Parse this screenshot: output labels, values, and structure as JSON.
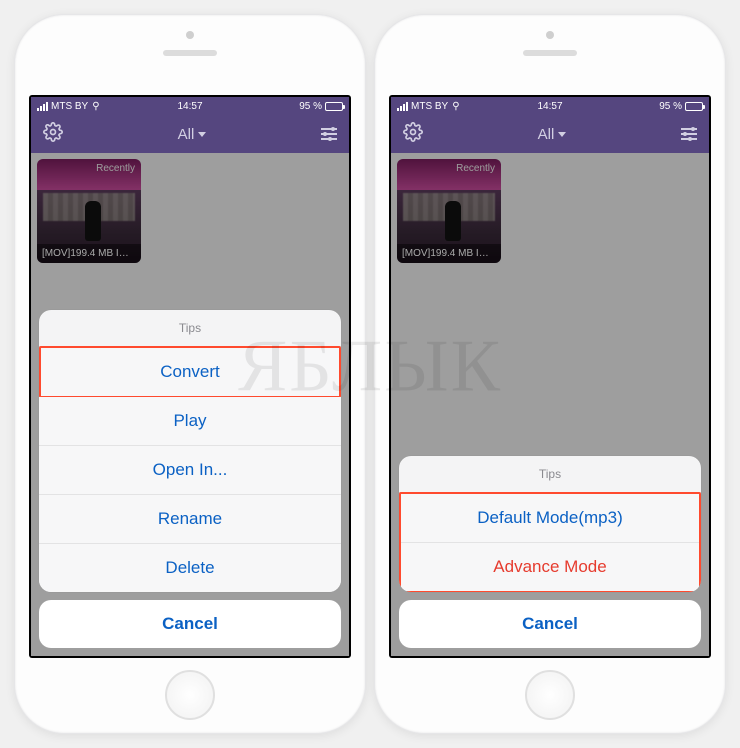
{
  "statusbar": {
    "carrier": "MTS BY",
    "time": "14:57",
    "battery_text": "95 %",
    "battery_pct": 95
  },
  "nav": {
    "title": "All"
  },
  "thumbnail": {
    "badge": "Recently",
    "caption": "[MOV]199.4 MB IMG_..."
  },
  "left_sheet": {
    "header": "Tips",
    "items": [
      {
        "label": "Convert",
        "destructive": false,
        "highlighted": true
      },
      {
        "label": "Play",
        "destructive": false,
        "highlighted": false
      },
      {
        "label": "Open In...",
        "destructive": false,
        "highlighted": false
      },
      {
        "label": "Rename",
        "destructive": false,
        "highlighted": false
      },
      {
        "label": "Delete",
        "destructive": false,
        "highlighted": false
      }
    ],
    "cancel": "Cancel"
  },
  "right_sheet": {
    "header": "Tips",
    "items": [
      {
        "label": "Default Mode(mp3)",
        "destructive": false,
        "highlighted": true
      },
      {
        "label": "Advance Mode",
        "destructive": true,
        "highlighted": true
      }
    ],
    "cancel": "Cancel"
  },
  "watermark": "ЯБЛЫК"
}
